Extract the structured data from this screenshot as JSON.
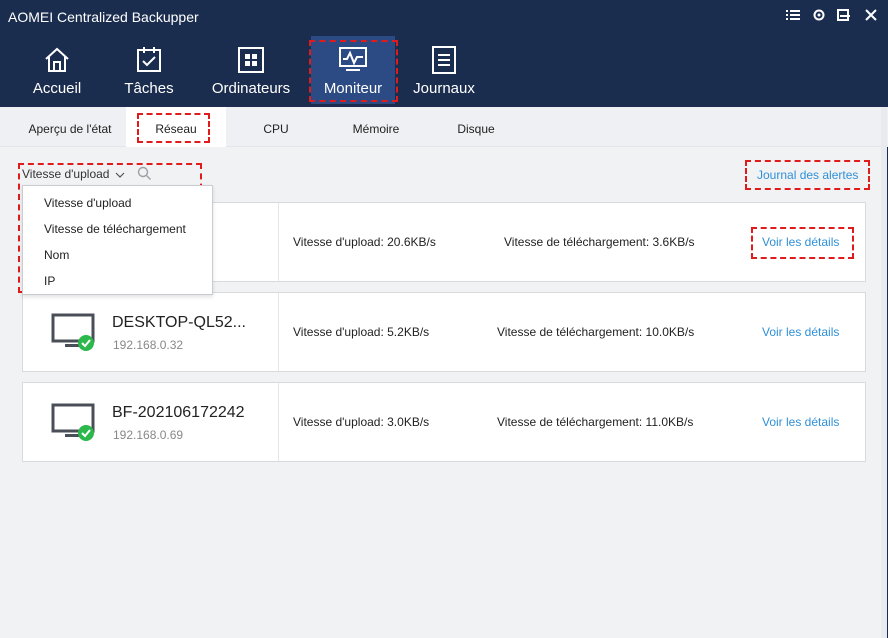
{
  "window": {
    "title": "AOMEI Centralized Backupper"
  },
  "window_controls": [
    "list-icon",
    "settings-icon",
    "minimize-icon",
    "maximize-icon",
    "close-icon"
  ],
  "nav": [
    {
      "label": "Accueil",
      "icon": "home-icon"
    },
    {
      "label": "Tâches",
      "icon": "task-icon"
    },
    {
      "label": "Ordinateurs",
      "icon": "computers-icon"
    },
    {
      "label": "Moniteur",
      "icon": "monitor-icon",
      "active": true
    },
    {
      "label": "Journaux",
      "icon": "log-icon"
    }
  ],
  "subtabs": [
    {
      "label": "Aperçu de l'état"
    },
    {
      "label": "Réseau",
      "active": true
    },
    {
      "label": "CPU"
    },
    {
      "label": "Mémoire"
    },
    {
      "label": "Disque"
    }
  ],
  "toolbar": {
    "sort_value": "Vitesse d'upload",
    "search_icon": "search-icon",
    "alerts_link": "Journal des alertes"
  },
  "sort_options": [
    "Vitesse d'upload",
    "Vitesse de téléchargement",
    "Nom",
    "IP"
  ],
  "computers": [
    {
      "name": "",
      "ip": "",
      "upload": "Vitesse d'upload:  20.6KB/s",
      "download": "Vitesse de téléchargement:  3.6KB/s",
      "details": "Voir les détails"
    },
    {
      "name": "DESKTOP-QL52...",
      "ip": "192.168.0.32",
      "upload": "Vitesse d'upload:  5.2KB/s",
      "download": "Vitesse de téléchargement:  10.0KB/s",
      "details": "Voir les détails"
    },
    {
      "name": "BF-202106172242",
      "ip": "192.168.0.69",
      "upload": "Vitesse d'upload:  3.0KB/s",
      "download": "Vitesse de téléchargement:  11.0KB/s",
      "details": "Voir les détails"
    }
  ],
  "colors": {
    "header_bg": "#1b2d4f",
    "active_nav": "#2c4a84",
    "link": "#2f90d8",
    "status_ok": "#2db84c",
    "highlight": "#e01b1b"
  }
}
